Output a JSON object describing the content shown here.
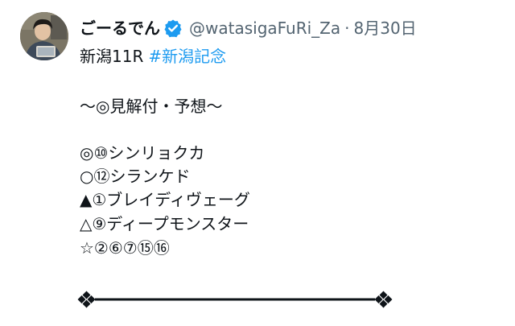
{
  "tweet": {
    "display_name": "ごーるでん",
    "handle": "@watasigaFuRi_Za",
    "separator": "·",
    "date": "8月30日",
    "line1_text": "新潟11R",
    "hashtag": "#新潟記念",
    "heading": "〜◎見解付・予想〜",
    "picks": [
      "◎⑩シンリョクカ",
      "○⑫シランケド",
      "▲①ブレイディヴェーグ",
      "△⑨ディープモンスター",
      "☆②⑥⑦⑮⑯"
    ]
  },
  "colors": {
    "text": "#0f1419",
    "secondary": "#536471",
    "link": "#1d9bf0",
    "verified": "#1d9bf0"
  },
  "icons": {
    "verified": "verified-badge-icon",
    "avatar": "user-avatar"
  }
}
